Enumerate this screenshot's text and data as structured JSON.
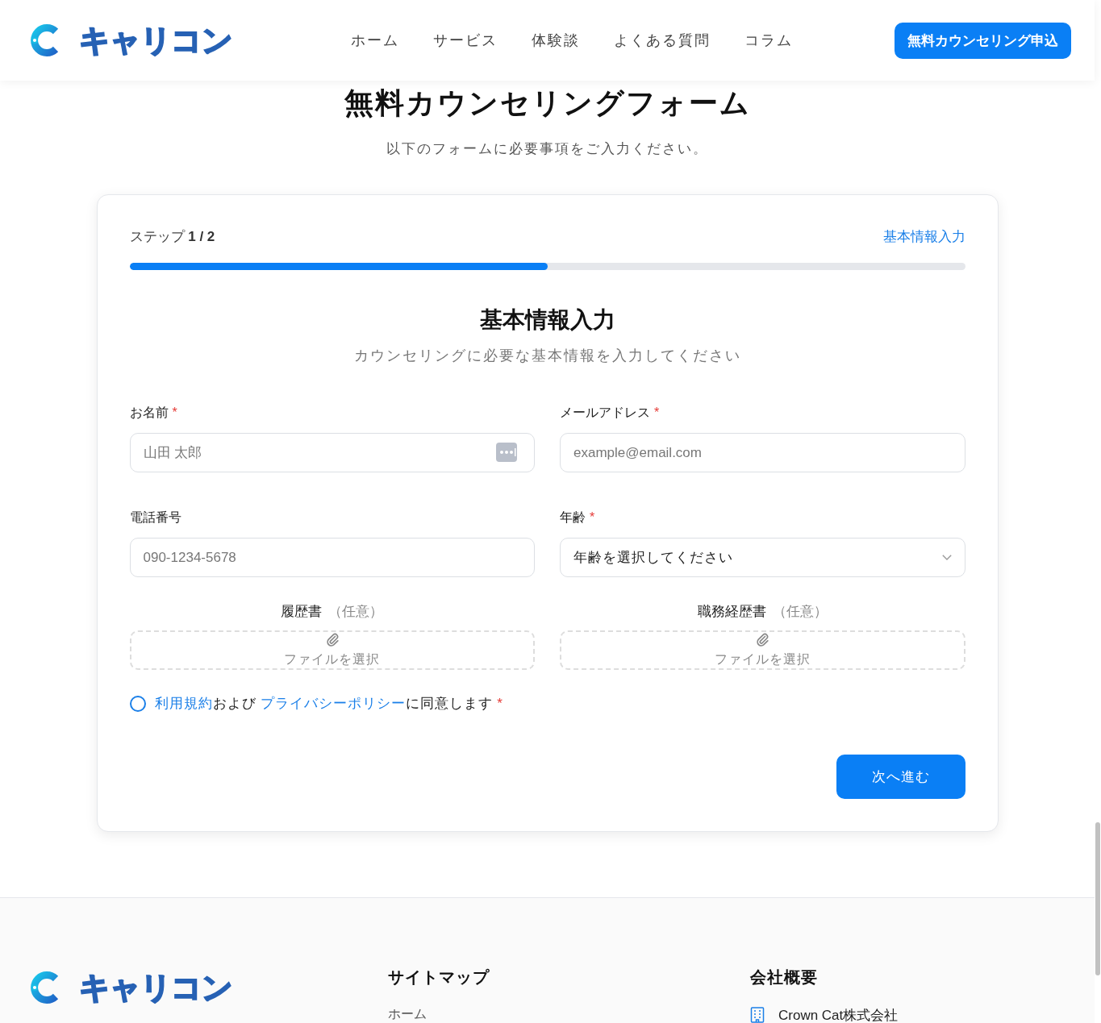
{
  "header": {
    "logo": "キャリコン",
    "nav": [
      {
        "label": "ホーム"
      },
      {
        "label": "サービス"
      },
      {
        "label": "体験談"
      },
      {
        "label": "よくある質問"
      },
      {
        "label": "コラム"
      }
    ],
    "cta": "無料カウンセリング申込"
  },
  "page": {
    "title": "無料カウンセリングフォーム",
    "subtitle": "以下のフォームに必要事項をご入力ください。"
  },
  "form": {
    "step": "ステップ **1 / 2**",
    "step_name": "基本情報入力",
    "progress": {
      "level": 0.5
    },
    "section_title": "基本情報入力",
    "section_subtitle": "カウンセリングに必要な基本情報を入力してください",
    "fields": [
      {
        "kind": "text",
        "label": "お名前",
        "required_mark": "*",
        "placeholder": "山田 太郎",
        "autofill_icon": true
      },
      {
        "kind": "text",
        "label": "メールアドレス",
        "required_mark": "*",
        "placeholder": "example@email.com",
        "autofill_icon": false
      },
      {
        "kind": "text",
        "label": "電話番号",
        "placeholder": "090-1234-5678",
        "autofill_icon": false
      },
      {
        "kind": "select",
        "label": "年齢",
        "required_mark": "*",
        "value": "年齢を選択してください"
      }
    ],
    "uploads": [
      {
        "label": "履歴書",
        "note": "（任意）",
        "button": "ファイルを選択"
      },
      {
        "label": "職務経歴書",
        "note": "（任意）",
        "button": "ファイルを選択"
      }
    ],
    "consent": {
      "checked": false,
      "parts": [
        {
          "kind": "link",
          "text": "利用規約"
        },
        {
          "kind": "text",
          "text": "および "
        },
        {
          "kind": "link",
          "text": "プライバシーポリシー"
        },
        {
          "kind": "text",
          "text": "に同意します"
        }
      ],
      "required_mark": "*"
    },
    "submit": "次へ進む"
  },
  "footer": {
    "logo": "キャリコン",
    "columns": [
      {
        "heading": "サイトマップ",
        "items": [
          {
            "kind": "link",
            "text": "ホーム"
          }
        ]
      },
      {
        "heading": "会社概要",
        "items": [
          {
            "kind": "company",
            "text": "Crown Cat株式会社"
          }
        ]
      }
    ]
  }
}
